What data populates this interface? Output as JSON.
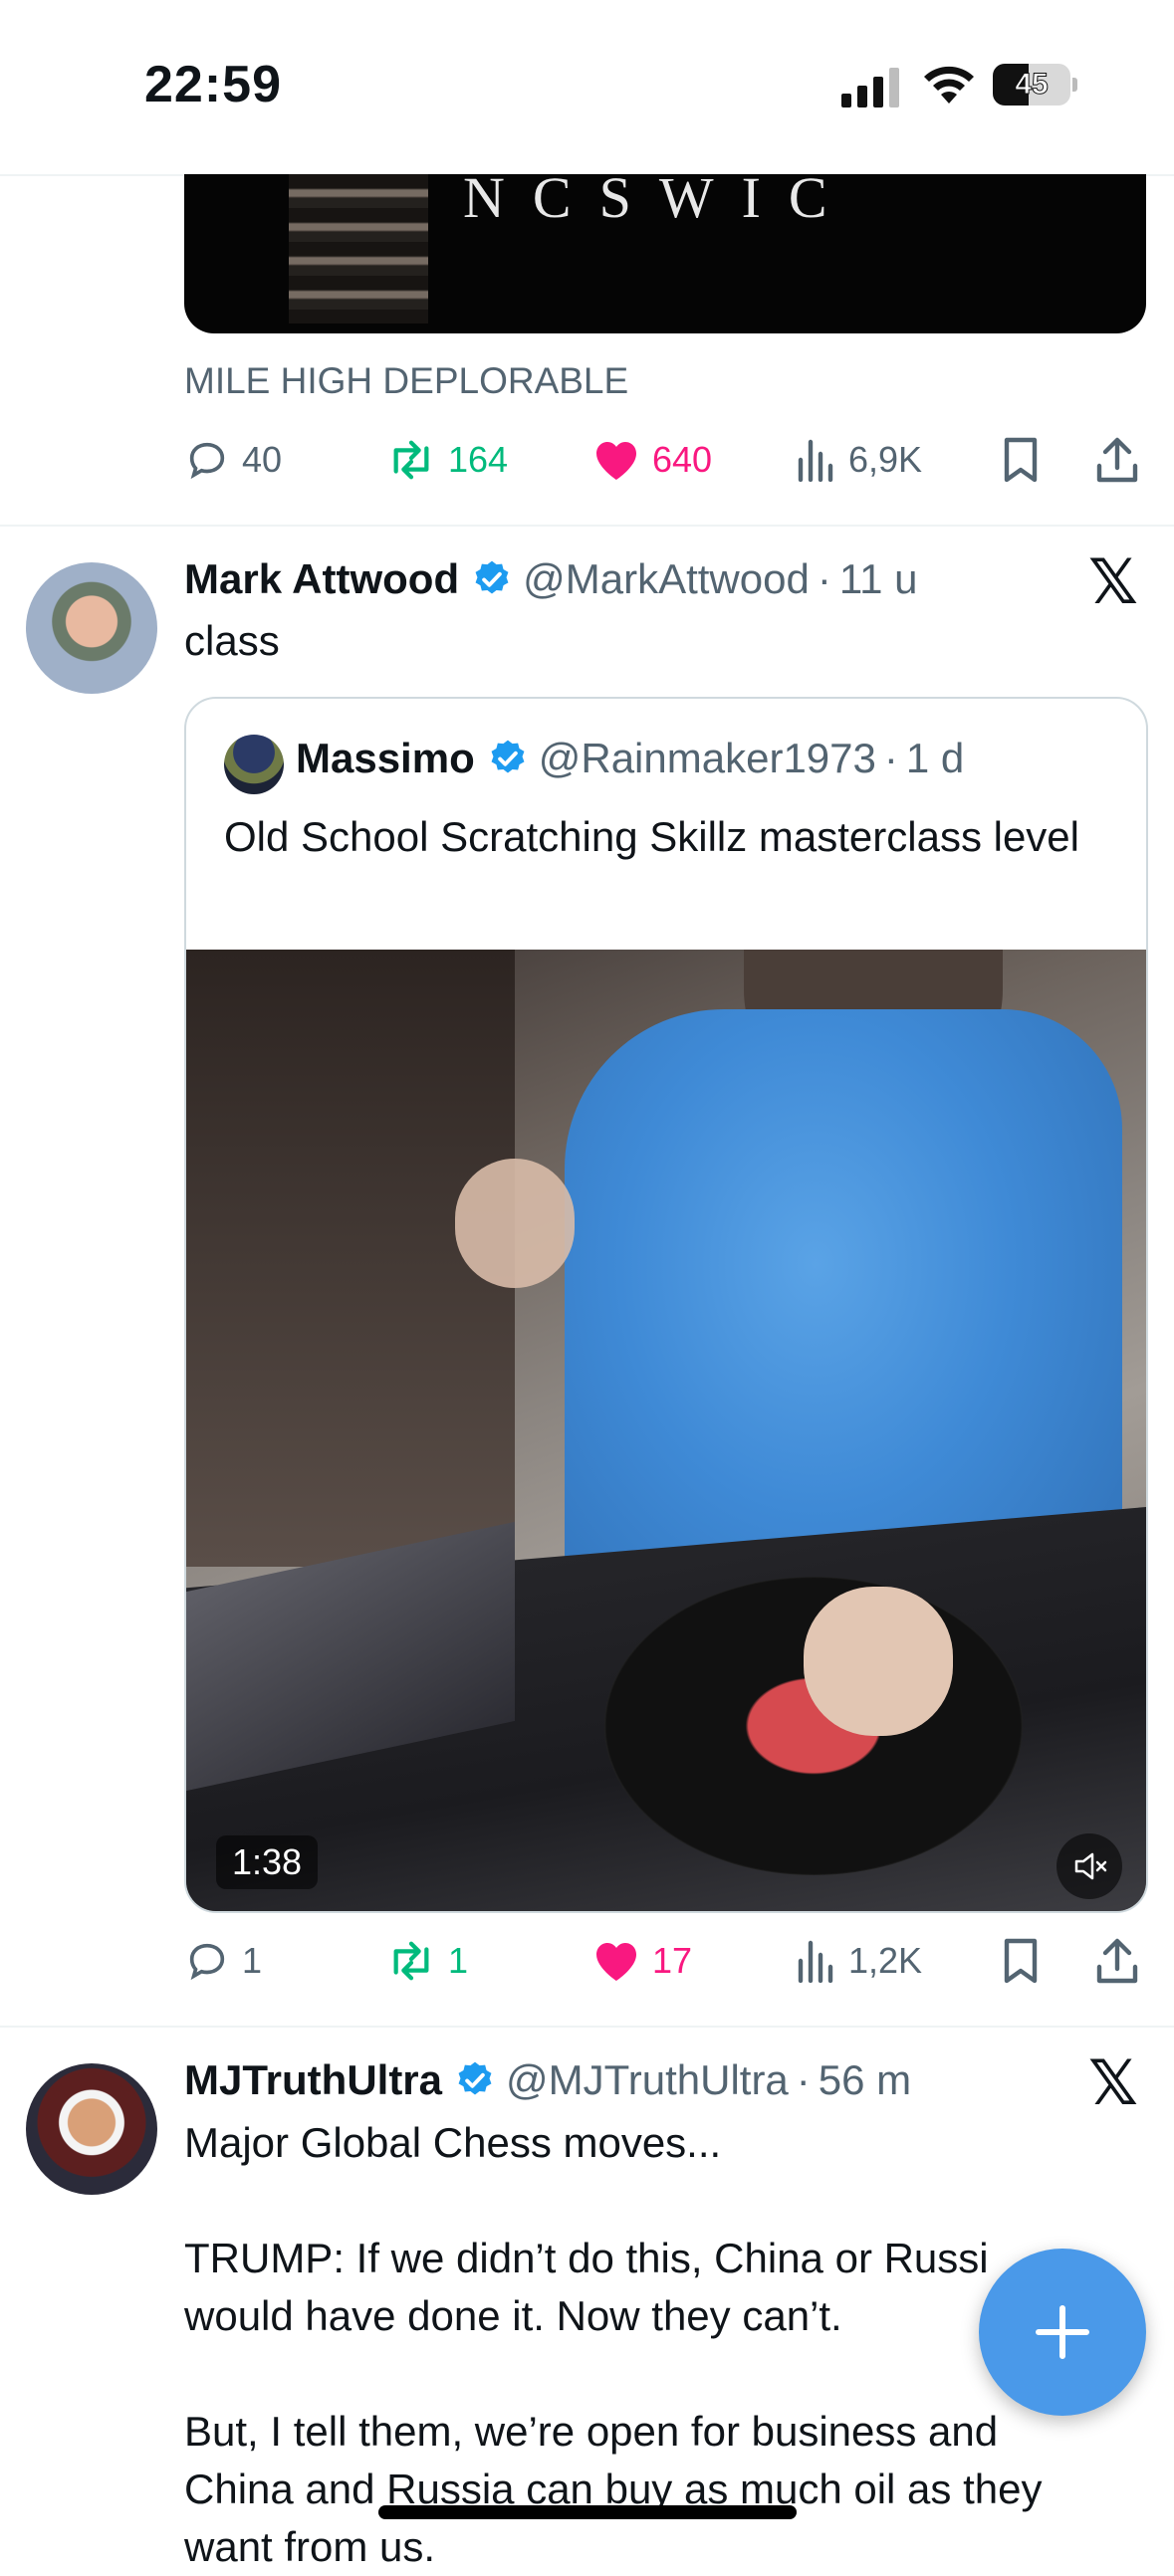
{
  "status_bar": {
    "time": "22:59",
    "battery": "45",
    "battery_level_percent": 45
  },
  "tweet1": {
    "media_text": "NCSWIC",
    "caption": "MILE HIGH DEPLORABLE",
    "replies": "40",
    "reposts": "164",
    "likes": "640",
    "views": "6,9K"
  },
  "tweet2": {
    "name": "Mark Attwood",
    "handle": "@MarkAttwood",
    "time": "11 u",
    "text": "class",
    "quote": {
      "name": "Massimo",
      "handle": "@Rainmaker1973",
      "time": "1 d",
      "text": "Old School Scratching Skillz masterclass level",
      "video_duration": "1:38"
    },
    "replies": "1",
    "reposts": "1",
    "likes": "17",
    "views": "1,2K"
  },
  "tweet3": {
    "name": "MJTruthUltra",
    "handle": "@MJTruthUltra",
    "time": "56 m",
    "line1": "Major Global Chess moves...",
    "para2a": "TRUMP: If we didn’t do this, China or Russi",
    "para2b": "would have done it. Now they can’t.",
    "para3a": "But, I tell them, we’re open for business and",
    "para3b": "China and Russia can buy as much oil as they",
    "para3c": "want from us."
  },
  "colors": {
    "accent": "#1d9bf0",
    "like": "#f91880",
    "repost": "#00ba7c",
    "fab": "#4a99e9"
  }
}
